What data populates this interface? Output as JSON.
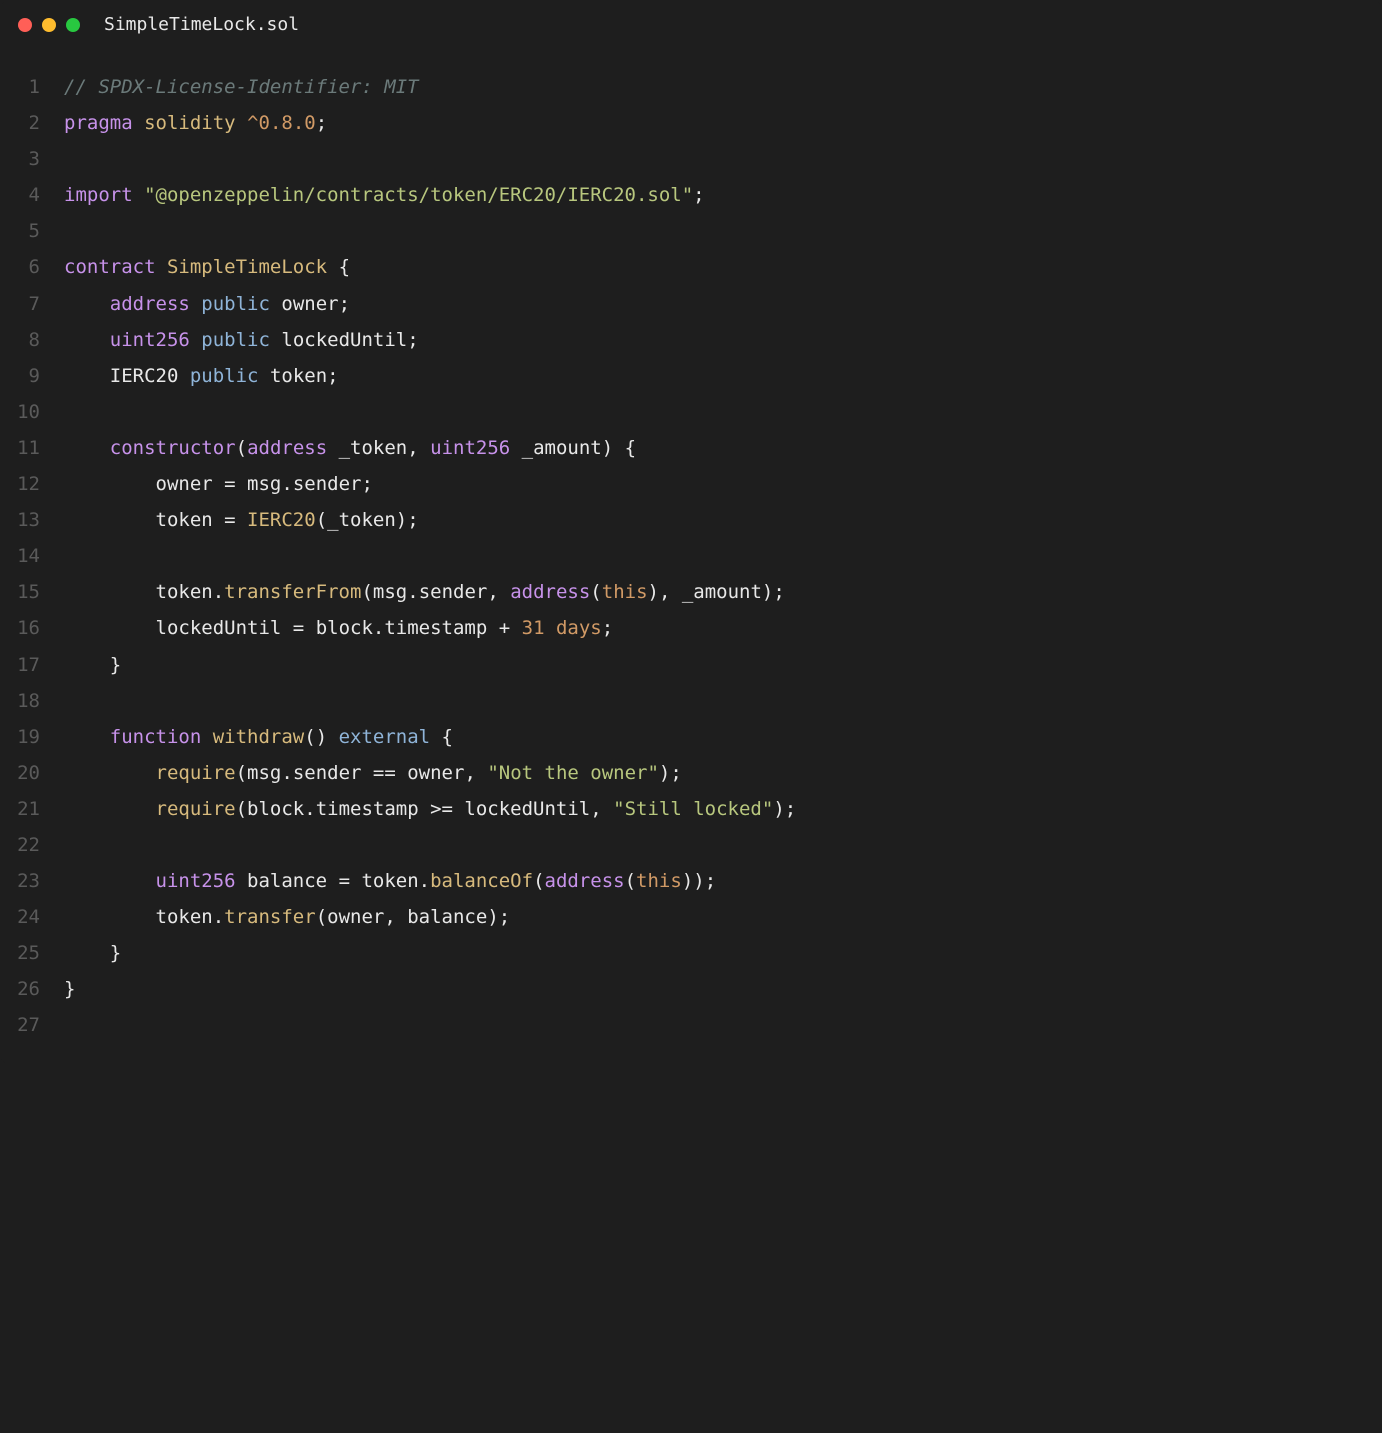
{
  "window": {
    "title": "SimpleTimeLock.sol"
  },
  "traffic_lights": {
    "red": "#ff5f57",
    "yellow": "#febc2e",
    "green": "#28c840"
  },
  "code": {
    "lines": [
      {
        "n": "1",
        "tokens": [
          [
            "c-comment",
            "// SPDX-License-Identifier: MIT"
          ]
        ]
      },
      {
        "n": "2",
        "tokens": [
          [
            "c-keyword",
            "pragma"
          ],
          [
            "c-punct",
            " "
          ],
          [
            "c-func",
            "solidity"
          ],
          [
            "c-punct",
            " "
          ],
          [
            "c-number",
            "^0.8.0"
          ],
          [
            "c-punct",
            ";"
          ]
        ]
      },
      {
        "n": "3",
        "tokens": []
      },
      {
        "n": "4",
        "tokens": [
          [
            "c-keyword",
            "import"
          ],
          [
            "c-punct",
            " "
          ],
          [
            "c-string",
            "\"@openzeppelin/contracts/token/ERC20/IERC20.sol\""
          ],
          [
            "c-punct",
            ";"
          ]
        ]
      },
      {
        "n": "5",
        "tokens": []
      },
      {
        "n": "6",
        "tokens": [
          [
            "c-keyword",
            "contract"
          ],
          [
            "c-punct",
            " "
          ],
          [
            "c-contract",
            "SimpleTimeLock"
          ],
          [
            "c-punct",
            " {"
          ]
        ]
      },
      {
        "n": "7",
        "tokens": [
          [
            "c-punct",
            "    "
          ],
          [
            "c-type",
            "address"
          ],
          [
            "c-punct",
            " "
          ],
          [
            "c-modifier",
            "public"
          ],
          [
            "c-punct",
            " "
          ],
          [
            "c-ident",
            "owner"
          ],
          [
            "c-punct",
            ";"
          ]
        ]
      },
      {
        "n": "8",
        "tokens": [
          [
            "c-punct",
            "    "
          ],
          [
            "c-type",
            "uint256"
          ],
          [
            "c-punct",
            " "
          ],
          [
            "c-modifier",
            "public"
          ],
          [
            "c-punct",
            " "
          ],
          [
            "c-ident",
            "lockedUntil"
          ],
          [
            "c-punct",
            ";"
          ]
        ]
      },
      {
        "n": "9",
        "tokens": [
          [
            "c-punct",
            "    "
          ],
          [
            "c-ident",
            "IERC20"
          ],
          [
            "c-punct",
            " "
          ],
          [
            "c-modifier",
            "public"
          ],
          [
            "c-punct",
            " "
          ],
          [
            "c-ident",
            "token"
          ],
          [
            "c-punct",
            ";"
          ]
        ]
      },
      {
        "n": "10",
        "tokens": []
      },
      {
        "n": "11",
        "tokens": [
          [
            "c-punct",
            "    "
          ],
          [
            "c-keyword",
            "constructor"
          ],
          [
            "c-punct",
            "("
          ],
          [
            "c-type",
            "address"
          ],
          [
            "c-punct",
            " "
          ],
          [
            "c-ident",
            "_token"
          ],
          [
            "c-punct",
            ", "
          ],
          [
            "c-type",
            "uint256"
          ],
          [
            "c-punct",
            " "
          ],
          [
            "c-ident",
            "_amount"
          ],
          [
            "c-punct",
            ") {"
          ]
        ]
      },
      {
        "n": "12",
        "tokens": [
          [
            "c-punct",
            "        "
          ],
          [
            "c-ident",
            "owner"
          ],
          [
            "c-punct",
            " = "
          ],
          [
            "c-ident",
            "msg"
          ],
          [
            "c-punct",
            "."
          ],
          [
            "c-ident",
            "sender"
          ],
          [
            "c-punct",
            ";"
          ]
        ]
      },
      {
        "n": "13",
        "tokens": [
          [
            "c-punct",
            "        "
          ],
          [
            "c-ident",
            "token"
          ],
          [
            "c-punct",
            " = "
          ],
          [
            "c-func",
            "IERC20"
          ],
          [
            "c-punct",
            "("
          ],
          [
            "c-ident",
            "_token"
          ],
          [
            "c-punct",
            ");"
          ]
        ]
      },
      {
        "n": "14",
        "tokens": []
      },
      {
        "n": "15",
        "tokens": [
          [
            "c-punct",
            "        "
          ],
          [
            "c-ident",
            "token"
          ],
          [
            "c-punct",
            "."
          ],
          [
            "c-func",
            "transferFrom"
          ],
          [
            "c-punct",
            "("
          ],
          [
            "c-ident",
            "msg"
          ],
          [
            "c-punct",
            "."
          ],
          [
            "c-ident",
            "sender"
          ],
          [
            "c-punct",
            ", "
          ],
          [
            "c-type",
            "address"
          ],
          [
            "c-punct",
            "("
          ],
          [
            "c-this",
            "this"
          ],
          [
            "c-punct",
            "), "
          ],
          [
            "c-ident",
            "_amount"
          ],
          [
            "c-punct",
            ");"
          ]
        ]
      },
      {
        "n": "16",
        "tokens": [
          [
            "c-punct",
            "        "
          ],
          [
            "c-ident",
            "lockedUntil"
          ],
          [
            "c-punct",
            " = "
          ],
          [
            "c-ident",
            "block"
          ],
          [
            "c-punct",
            "."
          ],
          [
            "c-ident",
            "timestamp"
          ],
          [
            "c-punct",
            " + "
          ],
          [
            "c-number",
            "31 days"
          ],
          [
            "c-punct",
            ";"
          ]
        ]
      },
      {
        "n": "17",
        "tokens": [
          [
            "c-punct",
            "    }"
          ]
        ]
      },
      {
        "n": "18",
        "tokens": []
      },
      {
        "n": "19",
        "tokens": [
          [
            "c-punct",
            "    "
          ],
          [
            "c-keyword",
            "function"
          ],
          [
            "c-punct",
            " "
          ],
          [
            "c-func",
            "withdraw"
          ],
          [
            "c-punct",
            "() "
          ],
          [
            "c-modifier",
            "external"
          ],
          [
            "c-punct",
            " {"
          ]
        ]
      },
      {
        "n": "20",
        "tokens": [
          [
            "c-punct",
            "        "
          ],
          [
            "c-func",
            "require"
          ],
          [
            "c-punct",
            "("
          ],
          [
            "c-ident",
            "msg"
          ],
          [
            "c-punct",
            "."
          ],
          [
            "c-ident",
            "sender"
          ],
          [
            "c-punct",
            " == "
          ],
          [
            "c-ident",
            "owner"
          ],
          [
            "c-punct",
            ", "
          ],
          [
            "c-string",
            "\"Not the owner\""
          ],
          [
            "c-punct",
            ");"
          ]
        ]
      },
      {
        "n": "21",
        "tokens": [
          [
            "c-punct",
            "        "
          ],
          [
            "c-func",
            "require"
          ],
          [
            "c-punct",
            "("
          ],
          [
            "c-ident",
            "block"
          ],
          [
            "c-punct",
            "."
          ],
          [
            "c-ident",
            "timestamp"
          ],
          [
            "c-punct",
            " >= "
          ],
          [
            "c-ident",
            "lockedUntil"
          ],
          [
            "c-punct",
            ", "
          ],
          [
            "c-string",
            "\"Still locked\""
          ],
          [
            "c-punct",
            ");"
          ]
        ]
      },
      {
        "n": "22",
        "tokens": []
      },
      {
        "n": "23",
        "tokens": [
          [
            "c-punct",
            "        "
          ],
          [
            "c-type",
            "uint256"
          ],
          [
            "c-punct",
            " "
          ],
          [
            "c-ident",
            "balance"
          ],
          [
            "c-punct",
            " = "
          ],
          [
            "c-ident",
            "token"
          ],
          [
            "c-punct",
            "."
          ],
          [
            "c-func",
            "balanceOf"
          ],
          [
            "c-punct",
            "("
          ],
          [
            "c-type",
            "address"
          ],
          [
            "c-punct",
            "("
          ],
          [
            "c-this",
            "this"
          ],
          [
            "c-punct",
            "));"
          ]
        ]
      },
      {
        "n": "24",
        "tokens": [
          [
            "c-punct",
            "        "
          ],
          [
            "c-ident",
            "token"
          ],
          [
            "c-punct",
            "."
          ],
          [
            "c-func",
            "transfer"
          ],
          [
            "c-punct",
            "("
          ],
          [
            "c-ident",
            "owner"
          ],
          [
            "c-punct",
            ", "
          ],
          [
            "c-ident",
            "balance"
          ],
          [
            "c-punct",
            ");"
          ]
        ]
      },
      {
        "n": "25",
        "tokens": [
          [
            "c-punct",
            "    }"
          ]
        ]
      },
      {
        "n": "26",
        "tokens": [
          [
            "c-punct",
            "}"
          ]
        ]
      },
      {
        "n": "27",
        "tokens": []
      }
    ]
  }
}
